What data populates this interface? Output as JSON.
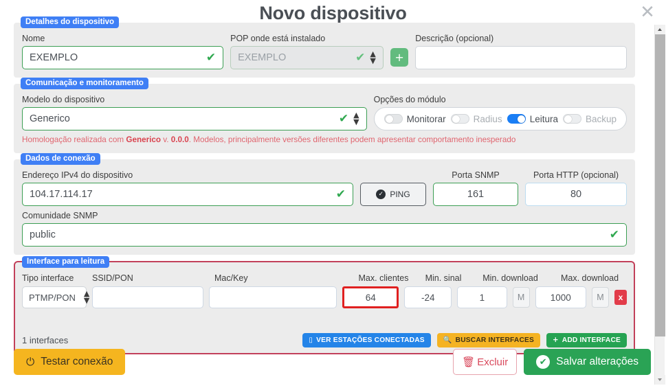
{
  "window": {
    "title": "Novo dispositivo",
    "close_icon": "close-icon"
  },
  "sections": {
    "device_details": {
      "legend": "Detalhes do dispositivo",
      "name": {
        "label": "Nome",
        "value": "EXEMPLO"
      },
      "pop": {
        "label": "POP onde está instalado",
        "value": "EXEMPLO"
      },
      "add_pop_button": "+",
      "description": {
        "label": "Descrição (opcional)",
        "value": ""
      }
    },
    "communication": {
      "legend": "Comunicação e monitoramento",
      "model": {
        "label": "Modelo do dispositivo",
        "value": "Generico"
      },
      "module_options": {
        "label": "Opções do módulo",
        "toggles": [
          {
            "label": "Monitorar",
            "on": false,
            "dim": false
          },
          {
            "label": "Radius",
            "on": false,
            "dim": true
          },
          {
            "label": "Leitura",
            "on": true,
            "dim": false
          },
          {
            "label": "Backup",
            "on": false,
            "dim": true
          }
        ]
      },
      "warning_prefix": "Homologação realizada com ",
      "warning_model": "Generico",
      "warning_mid": " v. ",
      "warning_version": "0.0.0",
      "warning_suffix": ". Modelos, principalmente versões diferentes podem apresentar comportamento inesperado"
    },
    "connection": {
      "legend": "Dados de conexão",
      "ipv4": {
        "label": "Endereço IPv4 do dispositivo",
        "value": "104.17.114.17"
      },
      "ping_button": "PING",
      "snmp_port": {
        "label": "Porta SNMP",
        "value": "161"
      },
      "http_port": {
        "label": "Porta HTTP (opcional)",
        "value": "80"
      },
      "community": {
        "label": "Comunidade SNMP",
        "value": "public"
      }
    },
    "interface": {
      "legend": "Interface para leitura",
      "columns": [
        "Tipo interface",
        "SSID/PON",
        "Mac/Key",
        "Max. clientes",
        "Min. sinal",
        "Min. download",
        "Max. download"
      ],
      "row": {
        "tipo_interface": "PTMP/PON",
        "ssid_pon": "",
        "mac_key": "",
        "max_clientes": "64",
        "min_sinal": "-24",
        "min_download": "1",
        "min_download_unit": "M",
        "max_download": "1000",
        "max_download_unit": "M",
        "delete_label": "x"
      },
      "count_text": "1 interfaces",
      "buttons": {
        "view_stations": "VER ESTAÇÕES CONECTADAS",
        "search_interfaces": "BUSCAR INTERFACES",
        "add_interface": "ADD INTERFACE"
      }
    }
  },
  "footer": {
    "test_connection": "Testar conexão",
    "delete": "Excluir",
    "save": "Salvar alterações"
  },
  "colors": {
    "legend_blue": "#3f7ff5",
    "valid_green": "#3b9e53",
    "warning_red": "#e0656f",
    "highlight_red": "#e02020",
    "panel_border_red": "#c2405a",
    "toggle_on_blue": "#1a7ef5",
    "save_green": "#2aa355",
    "amber": "#f5b51f"
  }
}
